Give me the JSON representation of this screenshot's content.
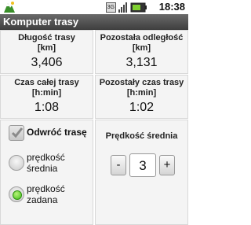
{
  "statusbar": {
    "clock": "18:38",
    "icons": [
      "app-logo-icon",
      "sim-icon",
      "signal-icon",
      "battery-icon"
    ]
  },
  "title": "Komputer trasy",
  "stats": {
    "distance": {
      "label_line1": "Długość trasy",
      "label_line2": "[km]",
      "value": "3,406"
    },
    "remaining": {
      "label_line1": "Pozostała odległość",
      "label_line2": "[km]",
      "value": "3,131"
    },
    "total_time": {
      "label_line1": "Czas całej trasy",
      "label_line2": "[h:min]",
      "value": "1:08"
    },
    "remaining_time": {
      "label_line1": "Pozostały czas trasy",
      "label_line2": "[h:min]",
      "value": "1:02"
    }
  },
  "options": {
    "reverse_label": "Odwróć trasę",
    "reverse_checked": true,
    "radio_average_line1": "prędkość",
    "radio_average_line2": "średnia",
    "radio_set_line1": "prędkość",
    "radio_set_line2": "zadana",
    "selected_radio": "set"
  },
  "speed": {
    "title": "Prędkość średnia",
    "minus_label": "-",
    "value": "3",
    "plus_label": "+"
  },
  "colors": {
    "titlebar": "#4a4a4a",
    "radio_selected": "#3fbf18"
  }
}
